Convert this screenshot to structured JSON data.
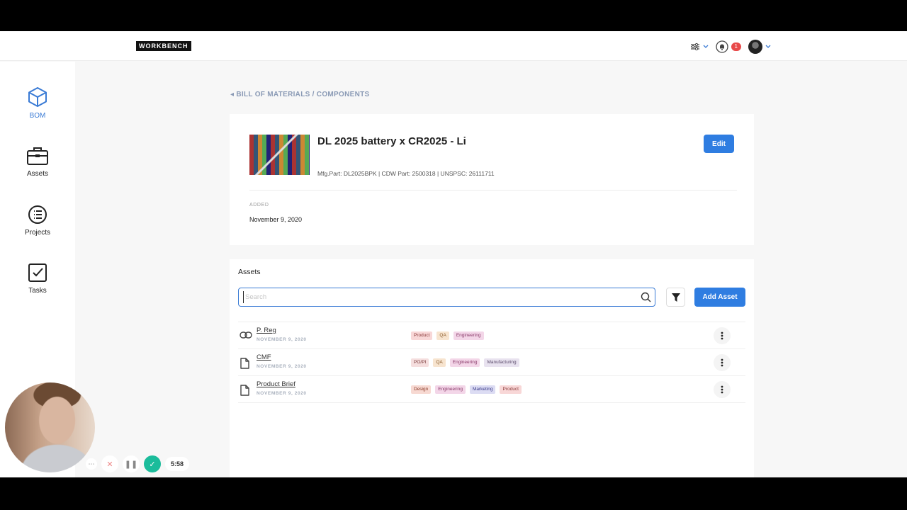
{
  "app": {
    "logo": "WORKBENCH",
    "notifications_count": "1"
  },
  "sidebar": {
    "items": [
      {
        "label": "BOM",
        "icon": "cube-icon"
      },
      {
        "label": "Assets",
        "icon": "briefcase-icon"
      },
      {
        "label": "Projects",
        "icon": "list-icon"
      },
      {
        "label": "Tasks",
        "icon": "checkbox-icon"
      }
    ]
  },
  "breadcrumb": "BILL OF MATERIALS / COMPONENTS",
  "component": {
    "title": "DL 2025 battery x CR2025 - Li",
    "meta": "Mfg.Part: DL2025BPK | CDW Part: 2500318 | UNSPSC: 26111711",
    "added_label": "ADDED",
    "added_date": "November 9, 2020",
    "edit_label": "Edit"
  },
  "assets": {
    "title": "Assets",
    "search_placeholder": "Search",
    "add_label": "Add Asset",
    "rows": [
      {
        "name": "P. Reg",
        "date": "NOVEMBER 9, 2020",
        "icon": "link-icon",
        "tags": [
          "Product",
          "QA",
          "Engineering"
        ]
      },
      {
        "name": "CMF",
        "date": "NOVEMBER 9, 2020",
        "icon": "document-icon",
        "tags": [
          "PO/PI",
          "QA",
          "Engineering",
          "Manufacturing"
        ]
      },
      {
        "name": "Product Brief",
        "date": "NOVEMBER 9, 2020",
        "icon": "document-icon",
        "tags": [
          "Design",
          "Engineering",
          "Marketing",
          "Product"
        ]
      }
    ]
  },
  "tag_colors": {
    "Product": "#f8d7d7",
    "QA": "#f7e4cf",
    "Engineering": "#f3d6e8",
    "PO/PI": "#f5dede",
    "Manufacturing": "#e8e2ef",
    "Design": "#f7d9d2",
    "Marketing": "#dcdcf3"
  },
  "recorder": {
    "timer": "5:58"
  },
  "colors": {
    "accent": "#2f7de1",
    "record": "#1bbc9b"
  }
}
